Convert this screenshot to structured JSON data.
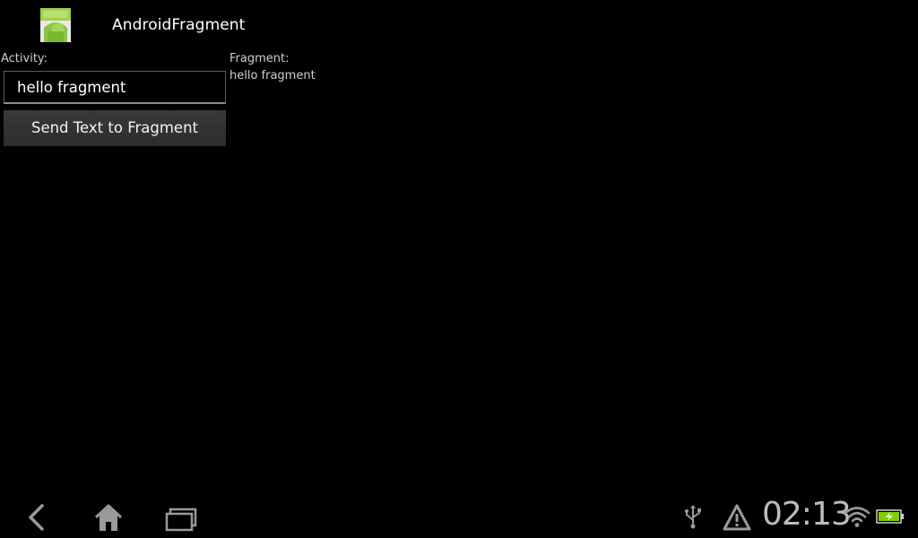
{
  "app": {
    "title": "AndroidFragment",
    "icon": "android-app-icon"
  },
  "activity": {
    "label": "Activity:",
    "input_value": "hello fragment",
    "button_label": "Send Text to Fragment"
  },
  "fragment": {
    "label": "Fragment:",
    "text": "hello fragment"
  },
  "system_bar": {
    "nav": [
      "back-icon",
      "home-icon",
      "recent-apps-icon"
    ],
    "status_icons": [
      "usb-icon",
      "warning-icon",
      "wifi-icon",
      "battery-icon"
    ],
    "clock": "02:13",
    "colors": {
      "battery_fill": "#7fd000",
      "icon_gray": "#9a9a9a"
    }
  }
}
